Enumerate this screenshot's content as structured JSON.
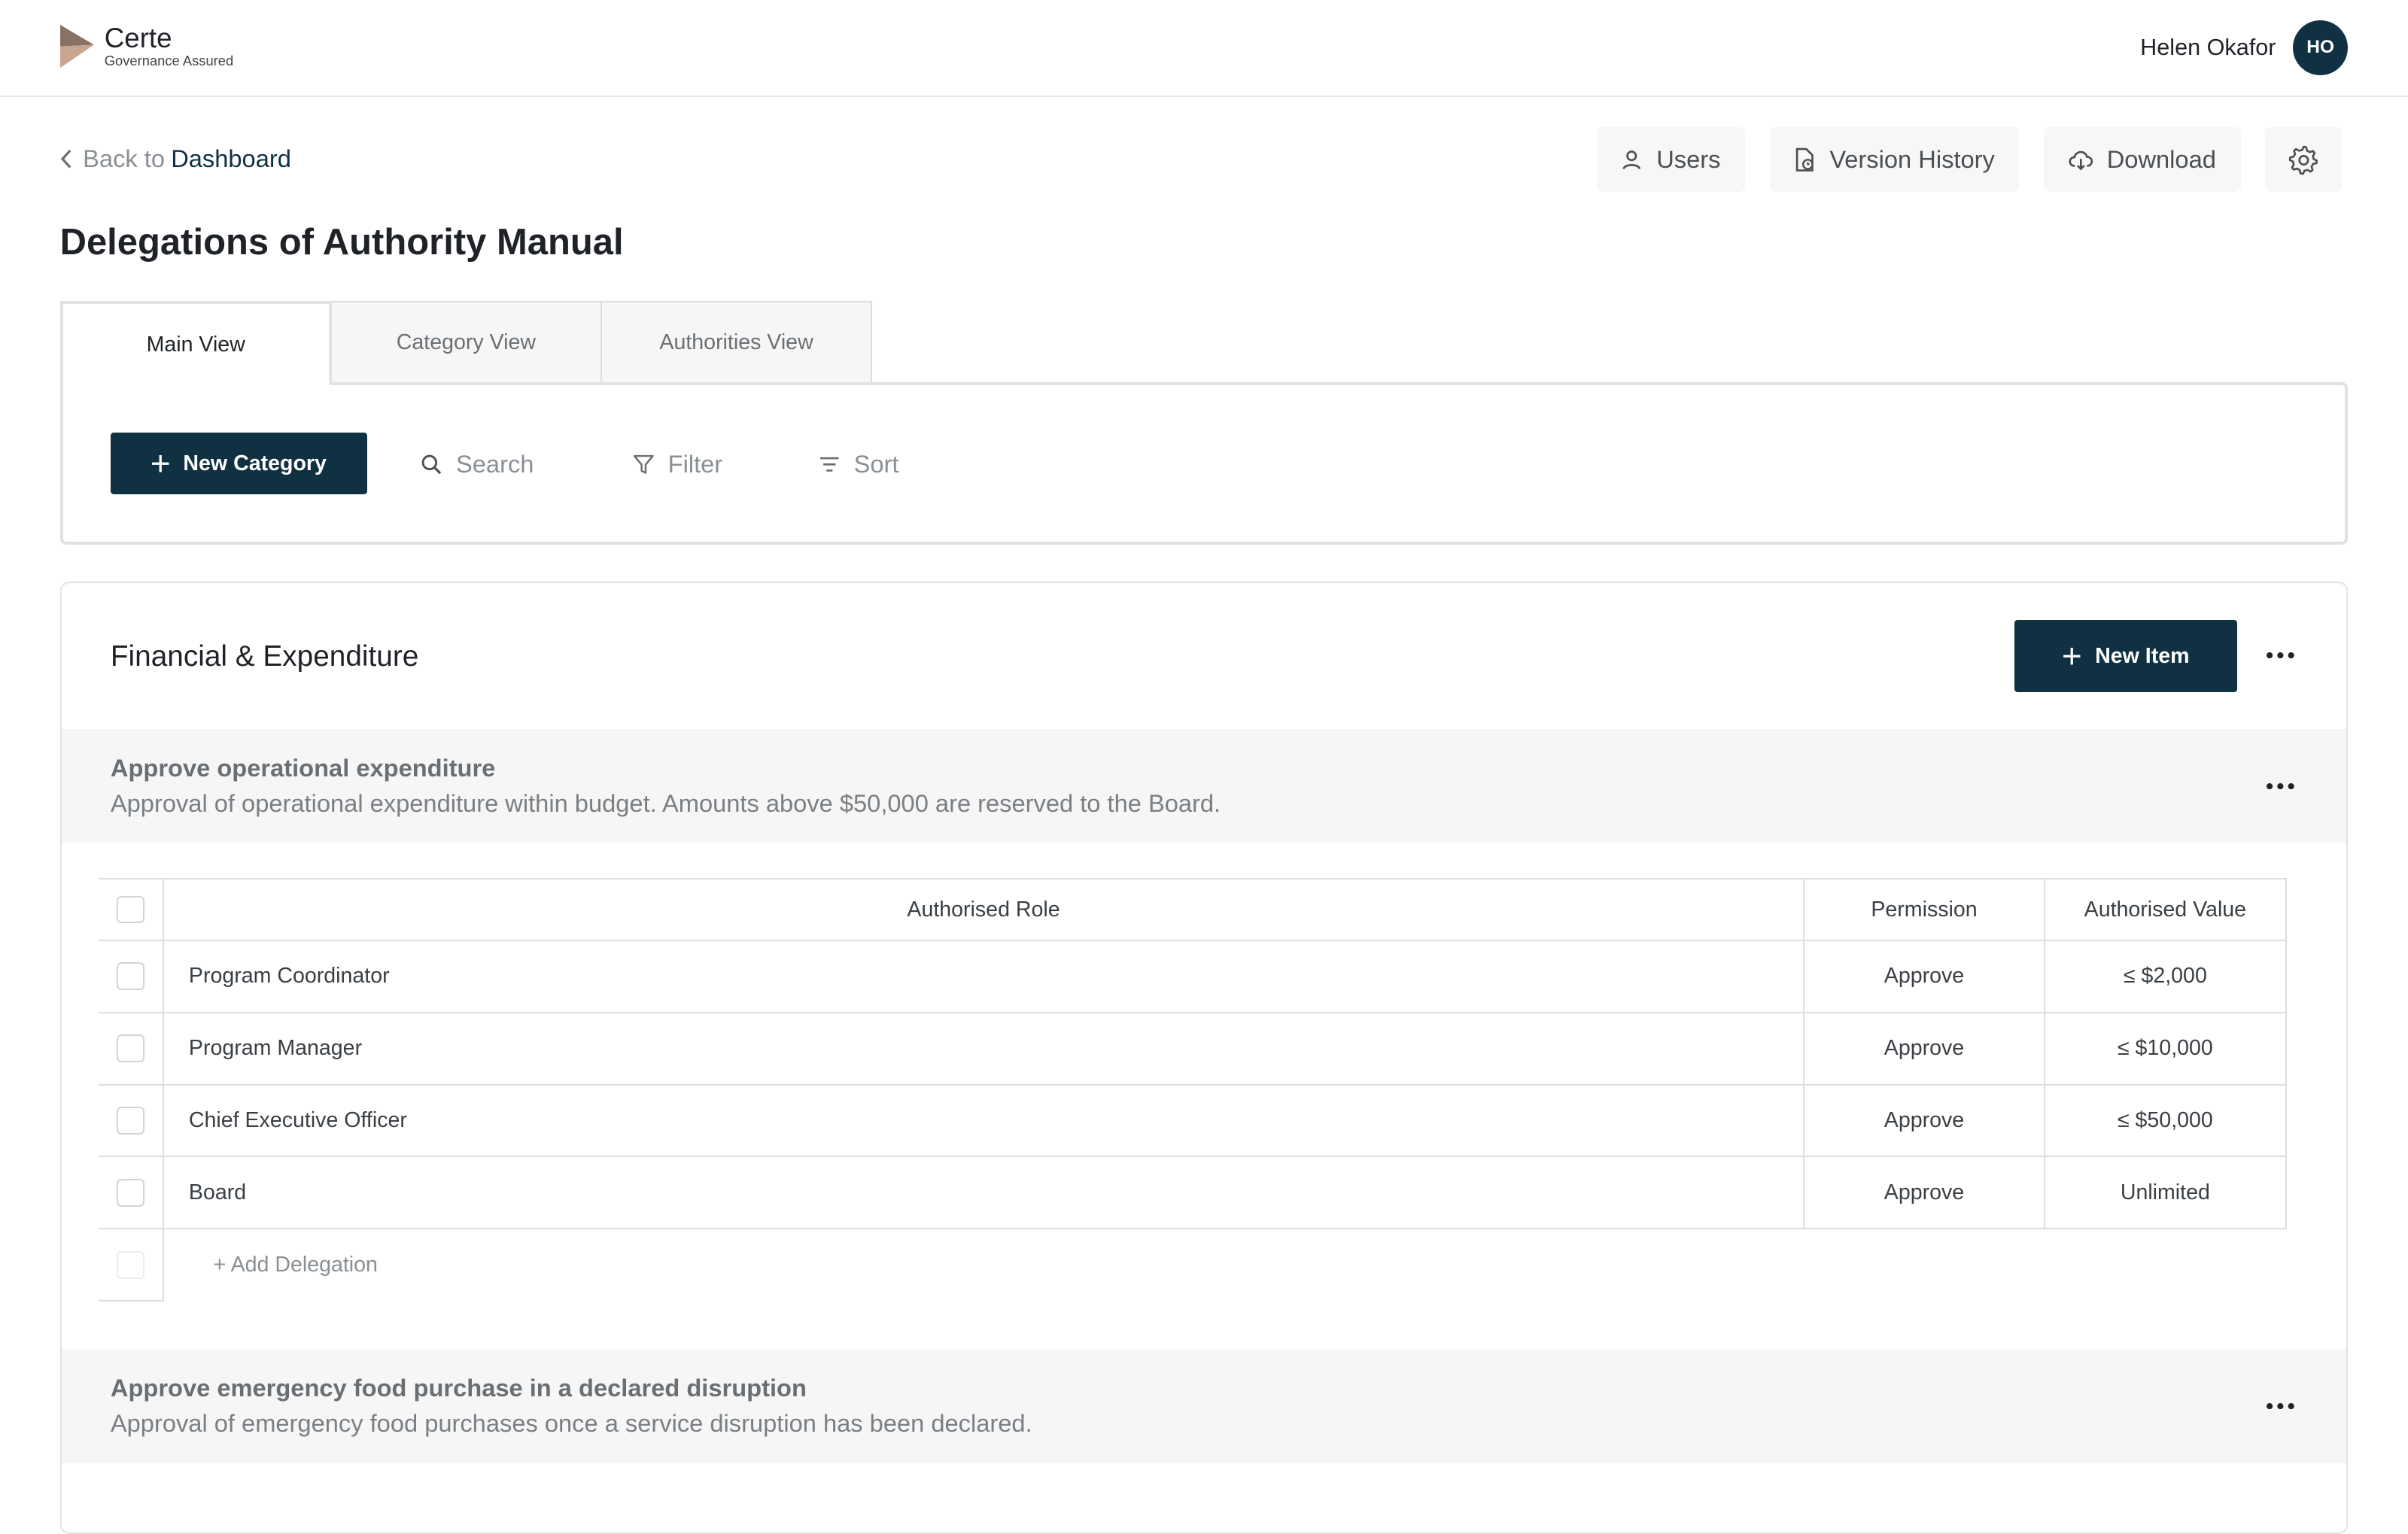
{
  "brand": {
    "name": "Certe",
    "tagline": "Governance Assured"
  },
  "user": {
    "name": "Helen Okafor",
    "initials": "HO"
  },
  "nav": {
    "back_prefix": "Back to",
    "back_link": "Dashboard"
  },
  "actions": {
    "users": "Users",
    "version_history": "Version History",
    "download": "Download"
  },
  "page": {
    "title": "Delegations of Authority Manual"
  },
  "tabs": [
    {
      "label": "Main View",
      "active": true
    },
    {
      "label": "Category View",
      "active": false
    },
    {
      "label": "Authorities View",
      "active": false
    }
  ],
  "toolbar": {
    "new_category": "New Category",
    "search": "Search",
    "filter": "Filter",
    "sort": "Sort"
  },
  "category": {
    "title": "Financial & Expenditure",
    "new_item": "New Item",
    "items": [
      {
        "title": "Approve operational expenditure",
        "description": "Approval of operational expenditure within budget. Amounts above $50,000 are reserved to the Board.",
        "columns": {
          "role": "Authorised Role",
          "permission": "Permission",
          "value": "Authorised Value"
        },
        "rows": [
          {
            "role": "Program Coordinator",
            "permission": "Approve",
            "value": "≤ $2,000"
          },
          {
            "role": "Program Manager",
            "permission": "Approve",
            "value": "≤ $10,000"
          },
          {
            "role": "Chief Executive Officer",
            "permission": "Approve",
            "value": "≤ $50,000"
          },
          {
            "role": "Board",
            "permission": "Approve",
            "value": "Unlimited"
          }
        ],
        "add_label": "+ Add Delegation"
      },
      {
        "title": "Approve emergency food purchase in a declared disruption",
        "description": "Approval of emergency food purchases once a service disruption has been declared."
      }
    ]
  },
  "colors": {
    "primary": "#0f3142",
    "panel": "#f6f6f6",
    "muted_text": "#8a8f94"
  }
}
